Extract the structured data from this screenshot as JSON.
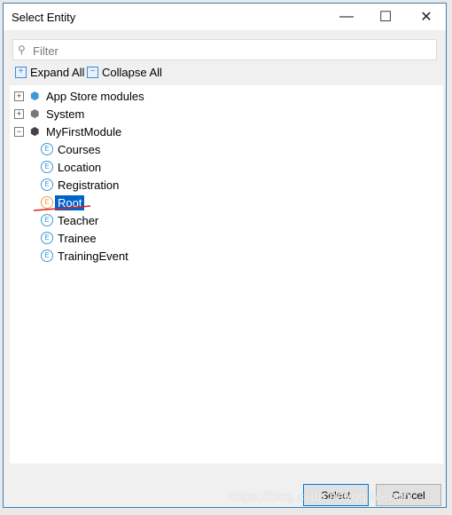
{
  "window": {
    "title": "Select Entity",
    "minimize": "—",
    "maximize": "☐",
    "close": "✕"
  },
  "filter": {
    "placeholder": "Filter",
    "value": ""
  },
  "toolbar": {
    "expand_all": "Expand All",
    "collapse_all": "Collapse All"
  },
  "tree": {
    "modules": [
      {
        "label": "App Store modules",
        "expanded": false
      },
      {
        "label": "System",
        "expanded": false
      },
      {
        "label": "MyFirstModule",
        "expanded": true
      }
    ],
    "entities": [
      "Courses",
      "Location",
      "Registration",
      "Root",
      "Teacher",
      "Trainee",
      "TrainingEvent"
    ],
    "selected": "Root"
  },
  "buttons": {
    "select": "Select",
    "cancel": "Cancel"
  },
  "watermark": "https://blog.csdn.net/qq  Mendix",
  "colors": {
    "accent": "#0063c8",
    "entity": "#3c9ad6",
    "selected_entity": "#f0a040",
    "annotation": "#e02020"
  }
}
